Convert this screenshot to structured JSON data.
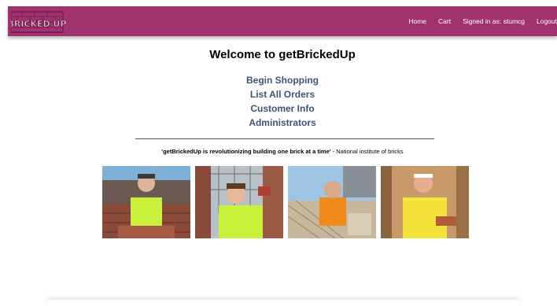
{
  "brand": {
    "logo_text": "BRICKED UP"
  },
  "nav": {
    "home": "Home",
    "cart": "Cart",
    "signed_in": "Signed in as: stumcg",
    "logout": "Logout"
  },
  "main": {
    "title": "Welcome to getBrickedUp",
    "links": {
      "begin_shopping": "Begin Shopping",
      "list_orders": "List All Orders",
      "customer_info": "Customer Info",
      "administrators": "Administrators"
    },
    "quote": {
      "text": "'getBrickedUp is revolutionizing building one brick at a time'",
      "source": " - National institute of bricks"
    }
  },
  "colors": {
    "navbar": "#a0336e",
    "link": "#3d5572"
  }
}
